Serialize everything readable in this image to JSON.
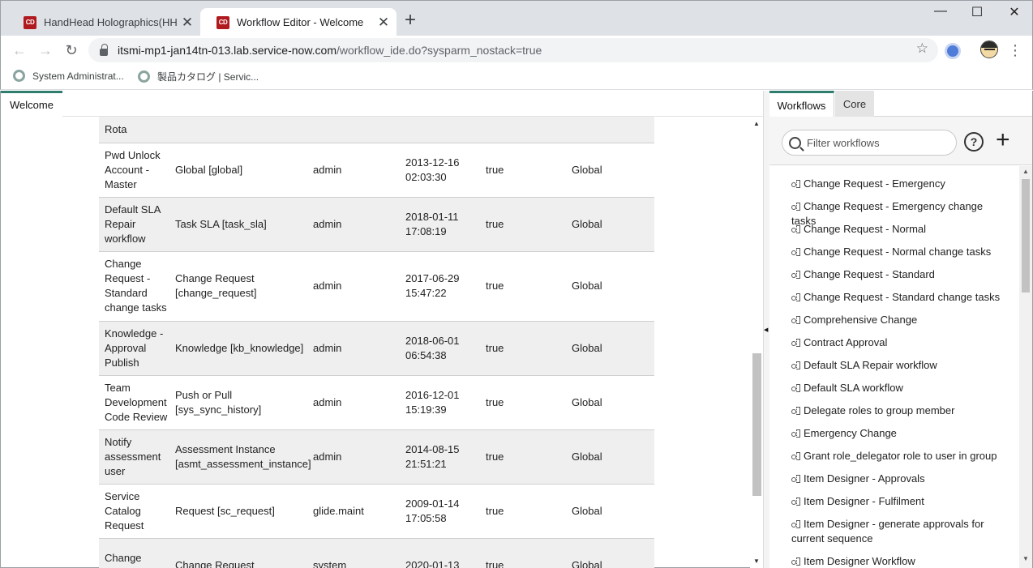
{
  "browser": {
    "tabs": [
      {
        "title": "HandHead Holographics(HHD) | I",
        "favicon": "CD",
        "active": false
      },
      {
        "title": "Workflow Editor - Welcome",
        "favicon": "CD",
        "active": true
      }
    ],
    "new_tab_symbol": "+",
    "close_symbol": "✕",
    "window_controls": {
      "minimize": "—",
      "maximize": "☐",
      "close": "✕"
    },
    "url_host": "itsmi-mp1-jan14tn-013.lab.service-now.com",
    "url_path": "/workflow_ide.do?sysparm_nostack=true",
    "bookmarks": [
      "System Administrat...",
      "製品カタログ | Servic..."
    ]
  },
  "editor": {
    "tab_label": "Welcome",
    "partial_top_label": "Rota",
    "rows": [
      {
        "name": "Pwd Unlock Account - Master",
        "table": "Global [global]",
        "updated_by": "admin",
        "updated": "2013-12-16 02:03:30",
        "active": "true",
        "domain": "Global"
      },
      {
        "name": "Default SLA Repair workflow",
        "table": "Task SLA [task_sla]",
        "updated_by": "admin",
        "updated": "2018-01-11 17:08:19",
        "active": "true",
        "domain": "Global"
      },
      {
        "name": "Change Request - Standard change tasks",
        "table": "Change Request [change_request]",
        "updated_by": "admin",
        "updated": "2017-06-29 15:47:22",
        "active": "true",
        "domain": "Global"
      },
      {
        "name": "Knowledge - Approval Publish",
        "table": "Knowledge [kb_knowledge]",
        "updated_by": "admin",
        "updated": "2018-06-01 06:54:38",
        "active": "true",
        "domain": "Global"
      },
      {
        "name": "Team Development Code Review",
        "table": "Push or Pull [sys_sync_history]",
        "updated_by": "admin",
        "updated": "2016-12-01 15:19:39",
        "active": "true",
        "domain": "Global"
      },
      {
        "name": "Notify assessment user",
        "table": "Assessment Instance [asmt_assessment_instance]",
        "updated_by": "admin",
        "updated": "2014-08-15 21:51:21",
        "active": "true",
        "domain": "Global"
      },
      {
        "name": "Service Catalog Request",
        "table": "Request [sc_request]",
        "updated_by": "glide.maint",
        "updated": "2009-01-14 17:05:58",
        "active": "true",
        "domain": "Global"
      },
      {
        "name": "Change Request -",
        "table": "Change Request",
        "updated_by": "system",
        "updated": "2020-01-13",
        "active": "true",
        "domain": "Global"
      }
    ]
  },
  "sidebar": {
    "tabs": [
      "Workflows",
      "Core"
    ],
    "filter_placeholder": "Filter workflows",
    "help_label": "?",
    "add_label": "+",
    "workflows": [
      "Change Request - Emergency",
      "Change Request - Emergency change tasks",
      "Change Request - Normal",
      "Change Request - Normal change tasks",
      "Change Request - Standard",
      "Change Request - Standard change tasks",
      "Comprehensive Change",
      "Contract Approval",
      "Default SLA Repair workflow",
      "Default SLA workflow",
      "Delegate roles to group member",
      "Emergency Change",
      "Grant role_delegator role to user in group",
      "Item Designer - Approvals",
      "Item Designer - Fulfilment",
      "Item Designer - generate approvals for current sequence",
      "Item Designer Workflow"
    ]
  }
}
